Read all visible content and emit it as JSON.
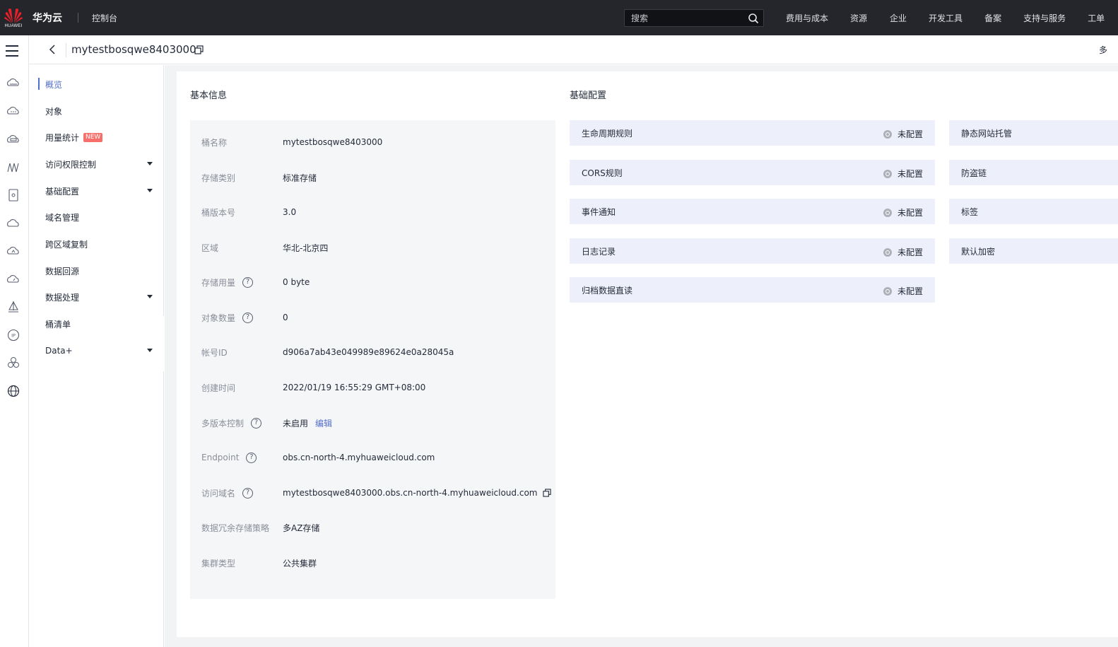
{
  "topbar": {
    "brand": "HUAWEI",
    "site_name": "华为云",
    "console": "控制台",
    "search_placeholder": "搜索",
    "nav": [
      "费用与成本",
      "资源",
      "企业",
      "开发工具",
      "备案",
      "支持与服务",
      "工单"
    ],
    "nav_icons": []
  },
  "header": {
    "bucket_name": "mytestbosqwe8403000",
    "more": "多"
  },
  "rail": {
    "icons": [
      "cloud-drive-icon",
      "cloud-dots-icon",
      "cloud-disk-icon",
      "signal-icon",
      "doc-icon",
      "cloud-icon",
      "cloud-arrow-icon",
      "cloud-gauge-icon",
      "sailboat-icon",
      "ip-icon",
      "cluster-icon",
      "globe-icon"
    ]
  },
  "leftnav": {
    "items": [
      {
        "label": "概览",
        "active": true
      },
      {
        "label": "对象"
      },
      {
        "label": "用量统计",
        "badge": "NEW"
      },
      {
        "label": "访问权限控制",
        "expandable": true
      },
      {
        "label": "基础配置",
        "expandable": true
      },
      {
        "label": "域名管理"
      },
      {
        "label": "跨区域复制"
      },
      {
        "label": "数据回源"
      },
      {
        "label": "数据处理",
        "expandable": true
      },
      {
        "label": "桶清单"
      },
      {
        "label": "Data+",
        "expandable": true
      }
    ]
  },
  "basic_info": {
    "title": "基本信息",
    "rows": [
      {
        "label": "桶名称",
        "value": "mytestbosqwe8403000"
      },
      {
        "label": "存储类别",
        "value": "标准存储"
      },
      {
        "label": "桶版本号",
        "value": "3.0"
      },
      {
        "label": "区域",
        "value": "华北-北京四"
      },
      {
        "label": "存储用量",
        "value": "0 byte",
        "help": true
      },
      {
        "label": "对象数量",
        "value": "0",
        "help": true
      },
      {
        "label": "帐号ID",
        "value": "d906a7ab43e049989e89624e0a28045a"
      },
      {
        "label": "创建时间",
        "value": "2022/01/19 16:55:29 GMT+08:00"
      },
      {
        "label": "多版本控制",
        "value": "未启用",
        "help": true,
        "link": "编辑"
      },
      {
        "label": "Endpoint",
        "value": "obs.cn-north-4.myhuaweicloud.com",
        "help": true
      },
      {
        "label": "访问域名",
        "value": "mytestbosqwe8403000.obs.cn-north-4.myhuaweicloud.com",
        "help": true,
        "copy": true
      },
      {
        "label": "数据冗余存储策略",
        "value": "多AZ存储"
      },
      {
        "label": "集群类型",
        "value": "公共集群"
      }
    ]
  },
  "base_config": {
    "title": "基础配置",
    "left": [
      {
        "label": "生命周期规则",
        "status": "未配置"
      },
      {
        "label": "CORS规则",
        "status": "未配置"
      },
      {
        "label": "事件通知",
        "status": "未配置"
      },
      {
        "label": "日志记录",
        "status": "未配置"
      },
      {
        "label": "归档数据直读",
        "status": "未配置"
      }
    ],
    "right": [
      {
        "label": "静态网站托管"
      },
      {
        "label": "防盗链"
      },
      {
        "label": "标签"
      },
      {
        "label": "默认加密"
      }
    ]
  },
  "colors": {
    "topbar": "#24262b",
    "accent": "#526ecc",
    "new_badge": "#f66f6a",
    "config_card": "#edf0fa",
    "info_panel": "#f5f6f8"
  }
}
